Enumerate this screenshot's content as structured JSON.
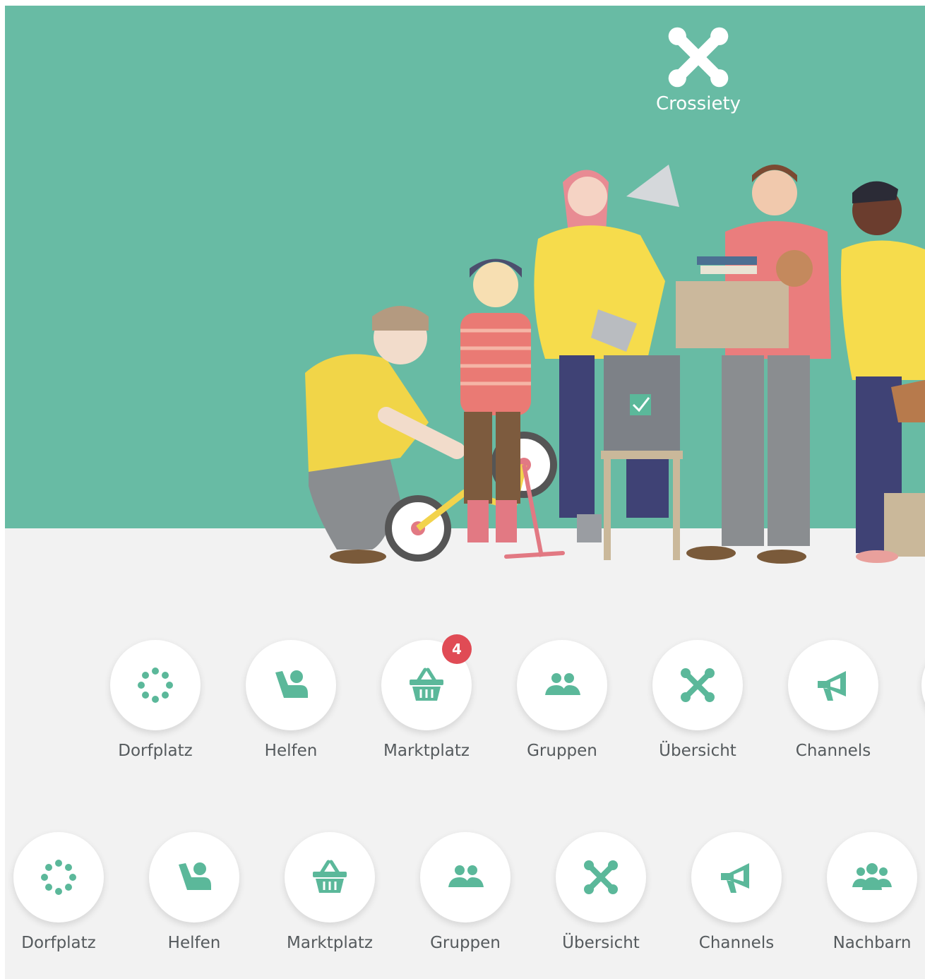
{
  "brand": {
    "name": "Crossiety",
    "logo_icon": "crossiety-x-logo"
  },
  "colors": {
    "hero_bg": "#68bba4",
    "page_bg": "#f2f2f2",
    "accent": "#5bb89a",
    "badge": "#e04b55"
  },
  "nav_primary": [
    {
      "label": "Dorfplatz",
      "icon": "dots-ring-icon"
    },
    {
      "label": "Helfen",
      "icon": "helping-hand-icon"
    },
    {
      "label": "Marktplatz",
      "icon": "basket-icon",
      "badge": "4"
    },
    {
      "label": "Gruppen",
      "icon": "people-icon"
    },
    {
      "label": "Übersicht",
      "icon": "crossiety-x-icon"
    },
    {
      "label": "Channels",
      "icon": "megaphone-icon"
    }
  ],
  "nav_secondary": [
    {
      "label": "Dorfplatz",
      "icon": "dots-ring-icon"
    },
    {
      "label": "Helfen",
      "icon": "helping-hand-icon"
    },
    {
      "label": "Marktplatz",
      "icon": "basket-icon"
    },
    {
      "label": "Gruppen",
      "icon": "people-icon"
    },
    {
      "label": "Übersicht",
      "icon": "crossiety-x-icon"
    },
    {
      "label": "Channels",
      "icon": "megaphone-icon"
    },
    {
      "label": "Nachbarn",
      "icon": "neighbors-icon"
    }
  ]
}
